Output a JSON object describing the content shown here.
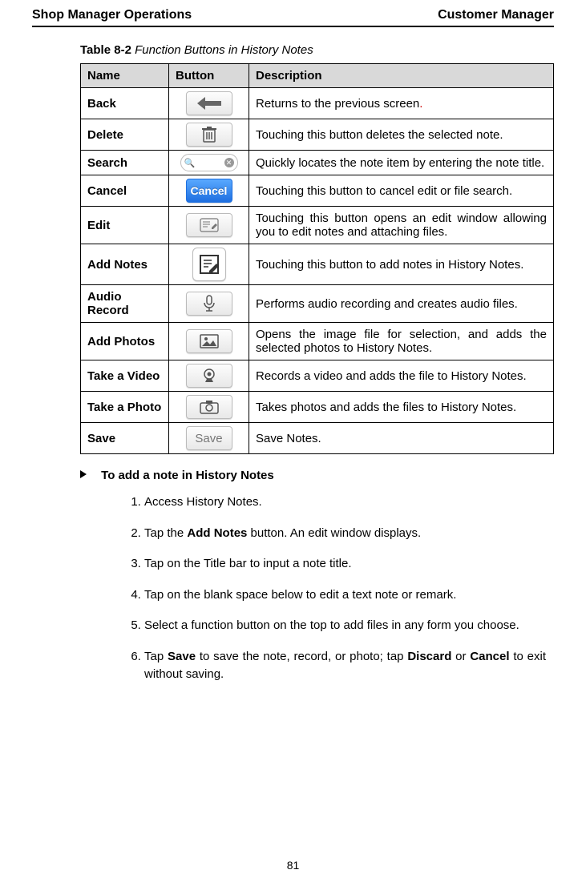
{
  "header": {
    "left": "Shop Manager Operations",
    "right": "Customer Manager"
  },
  "table_caption": {
    "number": "Table 8-2",
    "title": "Function Buttons in History Notes"
  },
  "table_headers": {
    "col1": "Name",
    "col2": "Button",
    "col3": "Description"
  },
  "rows": [
    {
      "name": "Back",
      "icon": "back-arrow-icon",
      "desc_pre": "Returns to the previous screen",
      "desc_red": ".",
      "desc_post": ""
    },
    {
      "name": "Delete",
      "icon": "trash-icon",
      "desc": "Touching this button deletes the selected note."
    },
    {
      "name": "Search",
      "icon": "search-box-icon",
      "desc": "Quickly locates the note item by entering the note title."
    },
    {
      "name": "Cancel",
      "icon": "cancel-button-icon",
      "label": "Cancel",
      "desc": "Touching this button to cancel edit or file search."
    },
    {
      "name": "Edit",
      "icon": "edit-note-icon",
      "desc": "Touching this button opens an edit window allowing you to edit notes and attaching files."
    },
    {
      "name": "Add Notes",
      "icon": "add-notes-icon",
      "desc": "Touching this button to add notes in History Notes."
    },
    {
      "name": "Audio Record",
      "icon": "microphone-icon",
      "desc": "Performs audio recording and creates audio files."
    },
    {
      "name": "Add Photos",
      "icon": "picture-icon",
      "desc": "Opens the image file for selection, and adds the selected photos to History Notes."
    },
    {
      "name": "Take a Video",
      "icon": "webcam-icon",
      "desc": "Records a video and adds the file to History Notes."
    },
    {
      "name": "Take a Photo",
      "icon": "camera-icon",
      "desc": "Takes photos and adds the files to History Notes."
    },
    {
      "name": "Save",
      "icon": "save-button-icon",
      "label": "Save",
      "desc": "Save Notes."
    }
  ],
  "procedure": {
    "title": "To add a note in History Notes",
    "steps": {
      "s1": "Access History Notes.",
      "s2_pre": "Tap the ",
      "s2_bold": "Add Notes",
      "s2_post": " button. An edit window displays.",
      "s3": "Tap on the Title bar to input a note title.",
      "s4": "Tap on the blank space below to edit a text note or remark.",
      "s5": "Select a function button on the top to add files in any form you choose.",
      "s6_pre": "Tap ",
      "s6_b1": "Save",
      "s6_mid1": " to save the note, record, or photo; tap ",
      "s6_b2": "Discard",
      "s6_mid2": " or ",
      "s6_b3": "Cancel",
      "s6_post": " to exit without saving."
    }
  },
  "page_number": "81"
}
